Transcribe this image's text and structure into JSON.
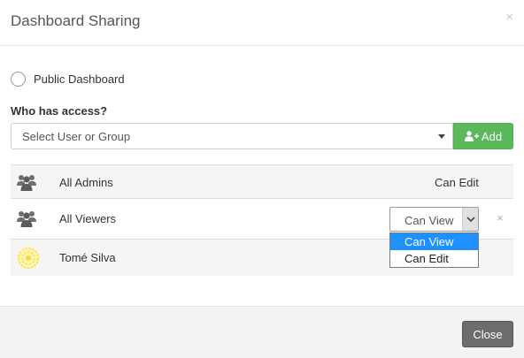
{
  "dialog": {
    "title": "Dashboard Sharing",
    "close_symbol": "×"
  },
  "public_option": {
    "label": "Public Dashboard",
    "checked": false
  },
  "access": {
    "heading": "Who has access?",
    "select_placeholder": "Select User or Group",
    "add_label": "Add",
    "add_icon": "user-plus-icon",
    "add_color": "#5cb85c"
  },
  "entries": [
    {
      "name": "All Admins",
      "permission": "Can Edit",
      "icon": "group-icon"
    },
    {
      "name": "All Viewers",
      "permission": "Can View",
      "icon": "group-icon",
      "remove_symbol": "×"
    },
    {
      "name": "Tomé Silva",
      "icon": "user-avatar-icon"
    }
  ],
  "permission_dropdown": {
    "options": [
      "Can View",
      "Can Edit"
    ],
    "selected": "Can View",
    "highlight_color": "#1e90ff"
  },
  "footer": {
    "close_label": "Close"
  }
}
